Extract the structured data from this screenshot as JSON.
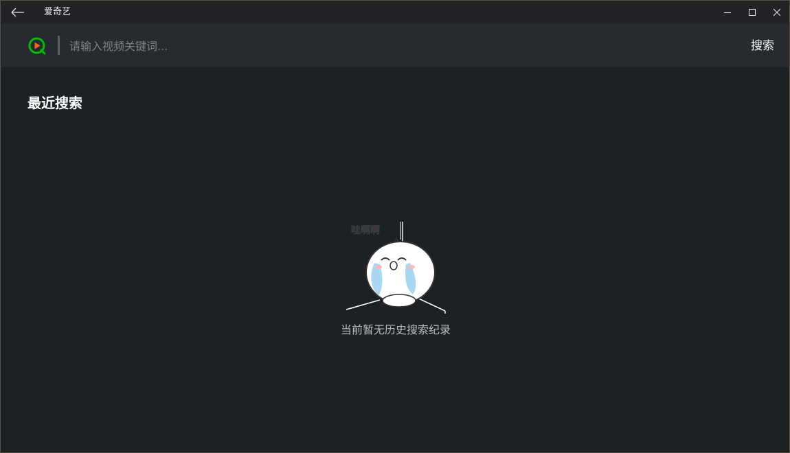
{
  "window": {
    "title": "爱奇艺"
  },
  "search": {
    "placeholder": "请输入视频关键词...",
    "value": "",
    "button_label": "搜索"
  },
  "recent": {
    "title": "最近搜索",
    "empty_message": "当前暂无历史搜索纪录",
    "illustration_caption": "哇啊啊"
  },
  "icons": {
    "back": "arrow-left-icon",
    "minimize": "minimize-icon",
    "maximize": "maximize-icon",
    "close": "close-icon",
    "logo": "iqiyi-logo-icon"
  },
  "colors": {
    "background": "#1c2124",
    "titlebar": "#212327",
    "searchbar": "#272b2f",
    "brand_green": "#00be06",
    "brand_play": "#f26b1d"
  }
}
